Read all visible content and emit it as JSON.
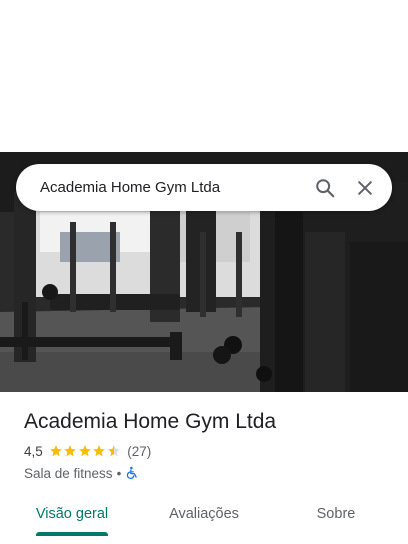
{
  "search": {
    "query": "Academia Home Gym Ltda"
  },
  "place": {
    "title": "Academia Home Gym Ltda",
    "rating": "4,5",
    "stars": 4.5,
    "review_count": "(27)",
    "category": "Sala de fitness",
    "separator": "•"
  },
  "tabs": [
    {
      "label": "Visão geral",
      "active": true
    },
    {
      "label": "Avaliações",
      "active": false
    },
    {
      "label": "Sobre",
      "active": false
    }
  ],
  "colors": {
    "accent": "#00796b",
    "star": "#fbbc04",
    "accessibility": "#1a73e8"
  },
  "icons": {
    "search": "search-icon",
    "close": "close-icon",
    "accessibility": "wheelchair-icon"
  }
}
